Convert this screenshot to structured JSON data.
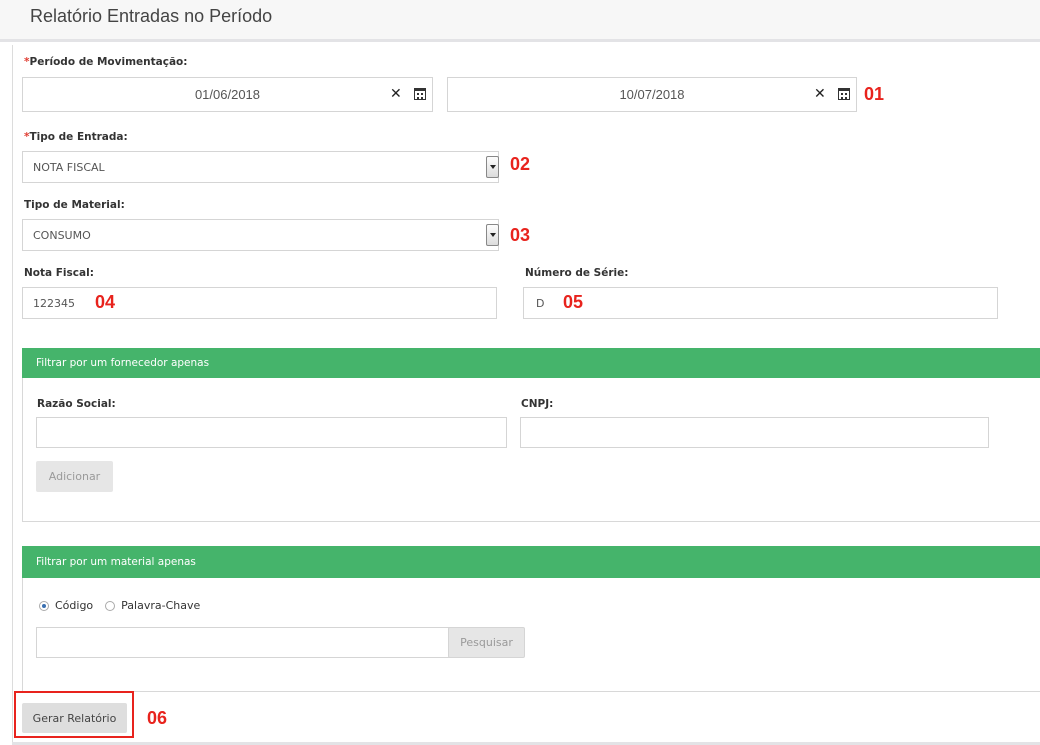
{
  "page": {
    "title": "Relatório Entradas no Período"
  },
  "periodo": {
    "required_mark": "*",
    "label": "Período de Movimentação:",
    "start_value": "01/06/2018",
    "end_value": "10/07/2018",
    "annotation": "01"
  },
  "tipo_entrada": {
    "required_mark": "*",
    "label": "Tipo de Entrada:",
    "value": "NOTA FISCAL",
    "annotation": "02"
  },
  "tipo_material": {
    "label": "Tipo de Material:",
    "value": "CONSUMO",
    "annotation": "03"
  },
  "nota_fiscal": {
    "label": "Nota Fiscal:",
    "value": "122345",
    "annotation": "04"
  },
  "numero_serie": {
    "label": "Número de Série:",
    "value": "D",
    "annotation": "05"
  },
  "fornecedor_panel": {
    "title": "Filtrar por um fornecedor apenas",
    "razao_label": "Razão Social:",
    "razao_value": "",
    "cnpj_label": "CNPJ:",
    "cnpj_value": "",
    "add_button": "Adicionar"
  },
  "material_panel": {
    "title": "Filtrar por um material apenas",
    "radio_codigo": "Código",
    "radio_palavra": "Palavra-Chave",
    "selected": "Código",
    "search_value": "",
    "search_button": "Pesquisar"
  },
  "generate": {
    "button": "Gerar Relatório",
    "annotation": "06"
  },
  "colors": {
    "panel_header": "#45b46b",
    "required": "#e03c31",
    "annotation": "#e8231d",
    "highlight_box": "#e8231d"
  },
  "icons": {
    "clear": "close-icon",
    "calendar": "calendar-icon",
    "dropdown": "chevron-down-icon"
  }
}
